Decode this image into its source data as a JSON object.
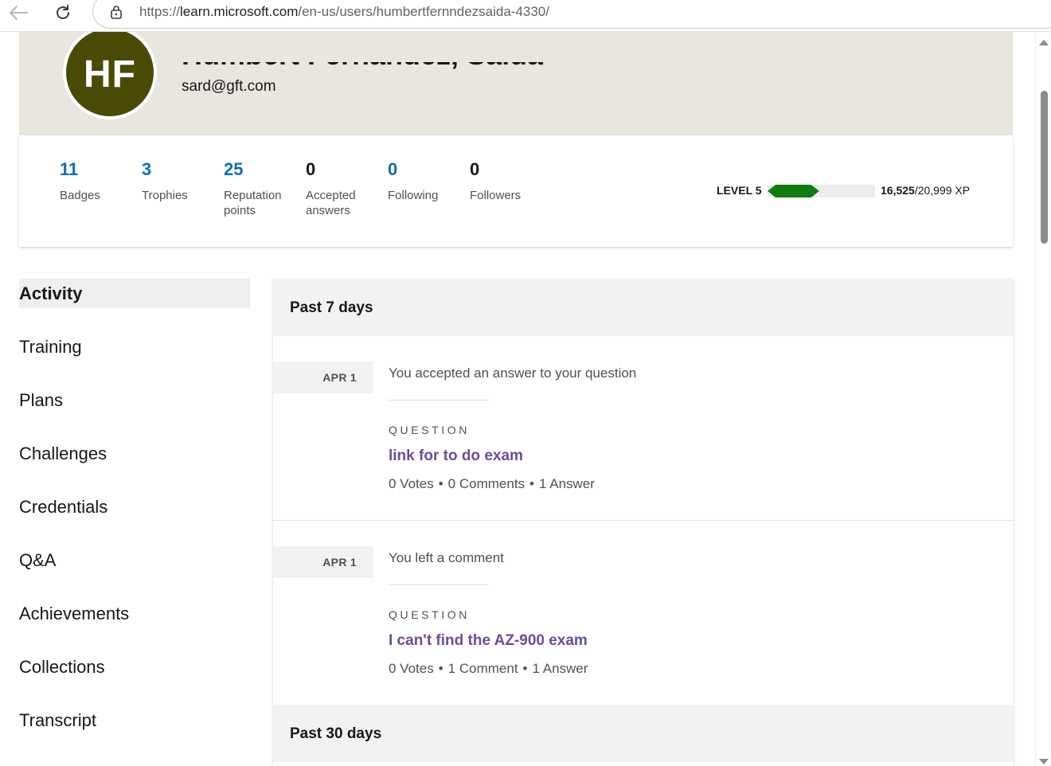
{
  "browser": {
    "url_prefix": "https://",
    "url_host": "learn.microsoft.com",
    "url_path": "/en-us/users/humbertfernndezsaida-4330/"
  },
  "profile": {
    "initials": "HF",
    "name": "Humbert Fernández, Saida",
    "email": "sard@gft.com",
    "avatar_color": "#4a4a05"
  },
  "stats": [
    {
      "value": "11",
      "label": "Badges"
    },
    {
      "value": "3",
      "label": "Trophies"
    },
    {
      "value": "25",
      "label": "Reputation points"
    },
    {
      "value": "0",
      "label": "Accepted answers"
    },
    {
      "value": "0",
      "label": "Following"
    },
    {
      "value": "0",
      "label": "Followers"
    }
  ],
  "level": {
    "label": "LEVEL 5",
    "xp_current": "16,525",
    "xp_total": "/20,999 XP",
    "progress_fraction": 0.48,
    "bar_color": "#107c10"
  },
  "nav": {
    "items": [
      {
        "label": "Activity",
        "active": true
      },
      {
        "label": "Training"
      },
      {
        "label": "Plans"
      },
      {
        "label": "Challenges"
      },
      {
        "label": "Credentials"
      },
      {
        "label": "Q&A"
      },
      {
        "label": "Achievements"
      },
      {
        "label": "Collections"
      },
      {
        "label": "Transcript"
      }
    ]
  },
  "activity": {
    "periods": [
      {
        "title": "Past 7 days"
      },
      {
        "title": "Past 30 days"
      }
    ],
    "entries": [
      {
        "date": "APR 1",
        "description": "You accepted an answer to your question",
        "eyebrow": "QUESTION",
        "title": "link for to do exam",
        "votes": "0 Votes",
        "comments": "0 Comments",
        "answers": "1 Answer"
      },
      {
        "date": "APR 1",
        "description": "You left a comment",
        "eyebrow": "QUESTION",
        "title": "I can't find the AZ-900 exam",
        "votes": "0 Votes",
        "comments": "1 Comment",
        "answers": "1 Answer"
      }
    ],
    "meta_separator": "•",
    "link_color": "#6b4c9a"
  }
}
